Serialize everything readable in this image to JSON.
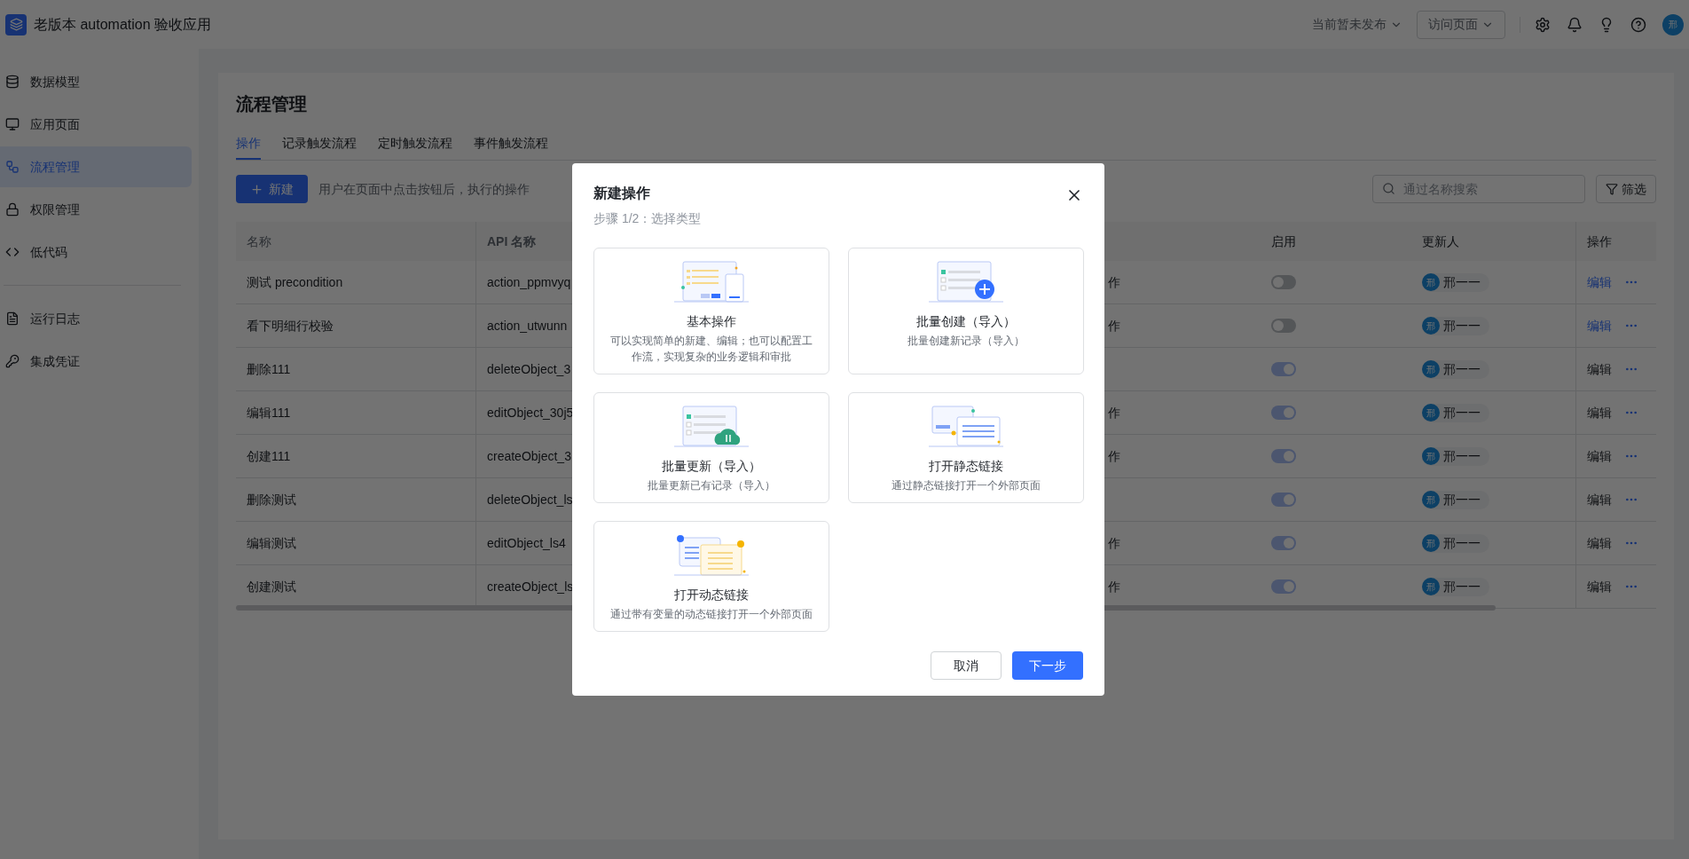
{
  "header": {
    "app_title": "老版本 automation 验收应用",
    "status_dropdown": "当前暂未发布",
    "visit_button": "访问页面",
    "avatar": "邢"
  },
  "sidebar": {
    "groups": [
      [
        {
          "label": "数据模型",
          "selected": false
        },
        {
          "label": "应用页面",
          "selected": false
        },
        {
          "label": "流程管理",
          "selected": true
        },
        {
          "label": "权限管理",
          "selected": false
        },
        {
          "label": "低代码",
          "selected": false
        }
      ],
      [
        {
          "label": "运行日志",
          "selected": false
        },
        {
          "label": "集成凭证",
          "selected": false
        }
      ]
    ]
  },
  "page": {
    "title": "流程管理",
    "tabs": [
      {
        "label": "操作",
        "selected": true
      },
      {
        "label": "记录触发流程",
        "selected": false
      },
      {
        "label": "定时触发流程",
        "selected": false
      },
      {
        "label": "事件触发流程",
        "selected": false
      }
    ],
    "new_button": "新建",
    "hint": "用户在页面中点击按钮后，执行的操作",
    "search": {
      "placeholder": "通过名称搜索"
    },
    "filter_button": "筛选"
  },
  "table": {
    "columns": {
      "name": "名称",
      "api_name": "API 名称",
      "enabled": "启用",
      "updater": "更新人",
      "actions": "操作"
    },
    "rows": [
      {
        "name": "测试 precondition",
        "api_name": "action_ppmvyq",
        "column_3": "作",
        "on": false,
        "disabled": false,
        "avatar": "邢",
        "updater": "邢一一",
        "edit": "编辑"
      },
      {
        "name": "看下明细行校验",
        "api_name": "action_utwunn",
        "column_3": "作",
        "on": false,
        "disabled": false,
        "avatar": "邢",
        "updater": "邢一一",
        "edit": "编辑"
      },
      {
        "name": "删除111",
        "api_name": "deleteObject_3",
        "on": true,
        "disabled": true,
        "avatar": "邢",
        "updater": "邢一一",
        "edit": "编辑"
      },
      {
        "name": "编辑111",
        "api_name": "editObject_30j5",
        "column_3": "作",
        "on": true,
        "disabled": true,
        "avatar": "邢",
        "updater": "邢一一",
        "edit": "编辑"
      },
      {
        "name": "创建111",
        "api_name": "createObject_3",
        "column_3": "作",
        "on": true,
        "disabled": true,
        "avatar": "邢",
        "updater": "邢一一",
        "edit": "编辑"
      },
      {
        "name": "删除测试",
        "api_name": "deleteObject_ls",
        "on": true,
        "disabled": true,
        "avatar": "邢",
        "updater": "邢一一",
        "edit": "编辑"
      },
      {
        "name": "编辑测试",
        "api_name": "editObject_ls4",
        "column_3": "作",
        "on": true,
        "disabled": true,
        "avatar": "邢",
        "updater": "邢一一",
        "edit": "编辑"
      },
      {
        "name": "创建测试",
        "api_name": "createObject_ls",
        "column_3": "作",
        "on": true,
        "disabled": true,
        "avatar": "邢",
        "updater": "邢一一",
        "edit": "编辑"
      }
    ]
  },
  "modal": {
    "title": "新建操作",
    "subtitle": "步骤 1/2：选择类型",
    "cards": [
      {
        "kind": "basic",
        "title": "基本操作",
        "description": "可以实现简单的新建、编辑；也可以配置工作流，实现复杂的业务逻辑和审批"
      },
      {
        "kind": "create",
        "title": "批量创建（导入）",
        "description": "批量创建新记录（导入）"
      },
      {
        "kind": "update",
        "title": "批量更新（导入）",
        "description": "批量更新已有记录（导入）"
      },
      {
        "kind": "static",
        "title": "打开静态链接",
        "description": "通过静态链接打开一个外部页面"
      },
      {
        "kind": "dynamic",
        "title": "打开动态链接",
        "description": "通过带有变量的动态链接打开一个外部页面"
      }
    ],
    "cancel_button": "取消",
    "next_button": "下一步"
  }
}
